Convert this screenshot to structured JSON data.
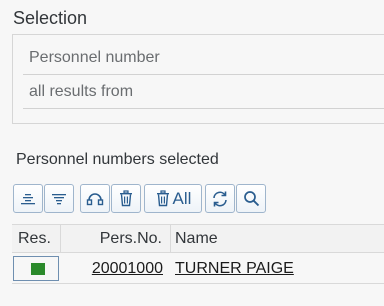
{
  "selection": {
    "title": "Selection",
    "fields": [
      {
        "label": "Personnel number"
      },
      {
        "label": "all results from"
      }
    ]
  },
  "list": {
    "title": "Personnel numbers selected",
    "toolbar": {
      "select_all_icon": "align-center-icon",
      "deselect_icon": "align-lines-icon",
      "link_icon": "link-icon",
      "delete_icon": "trash-icon",
      "delete_all_label": "All",
      "refresh_icon": "refresh-icon",
      "find_icon": "search-icon"
    },
    "columns": [
      "Res.",
      "Pers.No.",
      "Name"
    ],
    "rows": [
      {
        "status_color": "#2b8a2b",
        "pers_no": "20001000",
        "name": "TURNER PAIGE"
      }
    ]
  }
}
